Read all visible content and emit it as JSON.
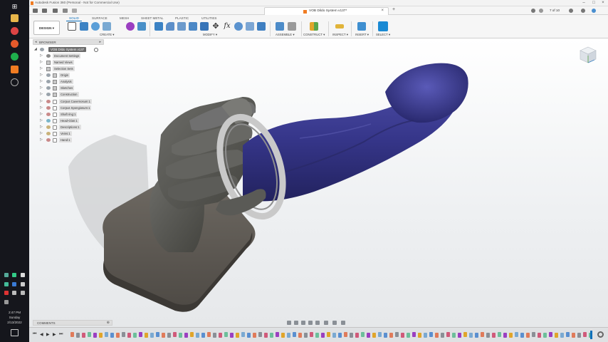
{
  "window": {
    "title": "Autodesk Fusion 360 (Personal - Not for Commercial Use)"
  },
  "document": {
    "tab_title": "VOB Dildo System v137*",
    "pager": "7 of 10"
  },
  "ribbon": {
    "tabs": [
      "SOLID",
      "SURFACE",
      "MESH",
      "SHEET METAL",
      "PLASTIC",
      "UTILITIES"
    ],
    "active_tab": "SOLID",
    "workspace_button": "DESIGN ▾",
    "groups": [
      "CREATE ▾",
      "MODIFY ▾",
      "ASSEMBLE ▾",
      "CONSTRUCT ▾",
      "INSPECT ▾",
      "INSERT ▾",
      "SELECT ▾"
    ]
  },
  "browser": {
    "title": "BROWSER",
    "root": "VOB Dildo System v137",
    "items": [
      {
        "label": "Document Settings",
        "type": "folder"
      },
      {
        "label": "Named Views",
        "type": "folder"
      },
      {
        "label": "Selection Sets",
        "type": "folder"
      },
      {
        "label": "Origin",
        "type": "folder"
      },
      {
        "label": "Analysis",
        "type": "folder"
      },
      {
        "label": "Sketches",
        "type": "folder"
      },
      {
        "label": "Construction",
        "type": "folder"
      },
      {
        "label": "Corpus Cavernosum:1",
        "type": "component"
      },
      {
        "label": "Corpus Spongiosum:1",
        "type": "component"
      },
      {
        "label": "Shaft ring:1",
        "type": "component"
      },
      {
        "label": "Head-Glan:1",
        "type": "component"
      },
      {
        "label": "Descriptions:1",
        "type": "component"
      },
      {
        "label": "Veins:1",
        "type": "component"
      },
      {
        "label": "Hand:1",
        "type": "component"
      }
    ]
  },
  "comments": {
    "label": "COMMENTS"
  },
  "taskbar": {
    "time": "2:47 PM",
    "day": "Sunday",
    "date": "2/13/2022"
  },
  "colors": {
    "accent": "#0d6fba",
    "model_shaft": "#3a3a8c",
    "model_hand": "#5c5c58",
    "ring": "#c9c9c9"
  }
}
